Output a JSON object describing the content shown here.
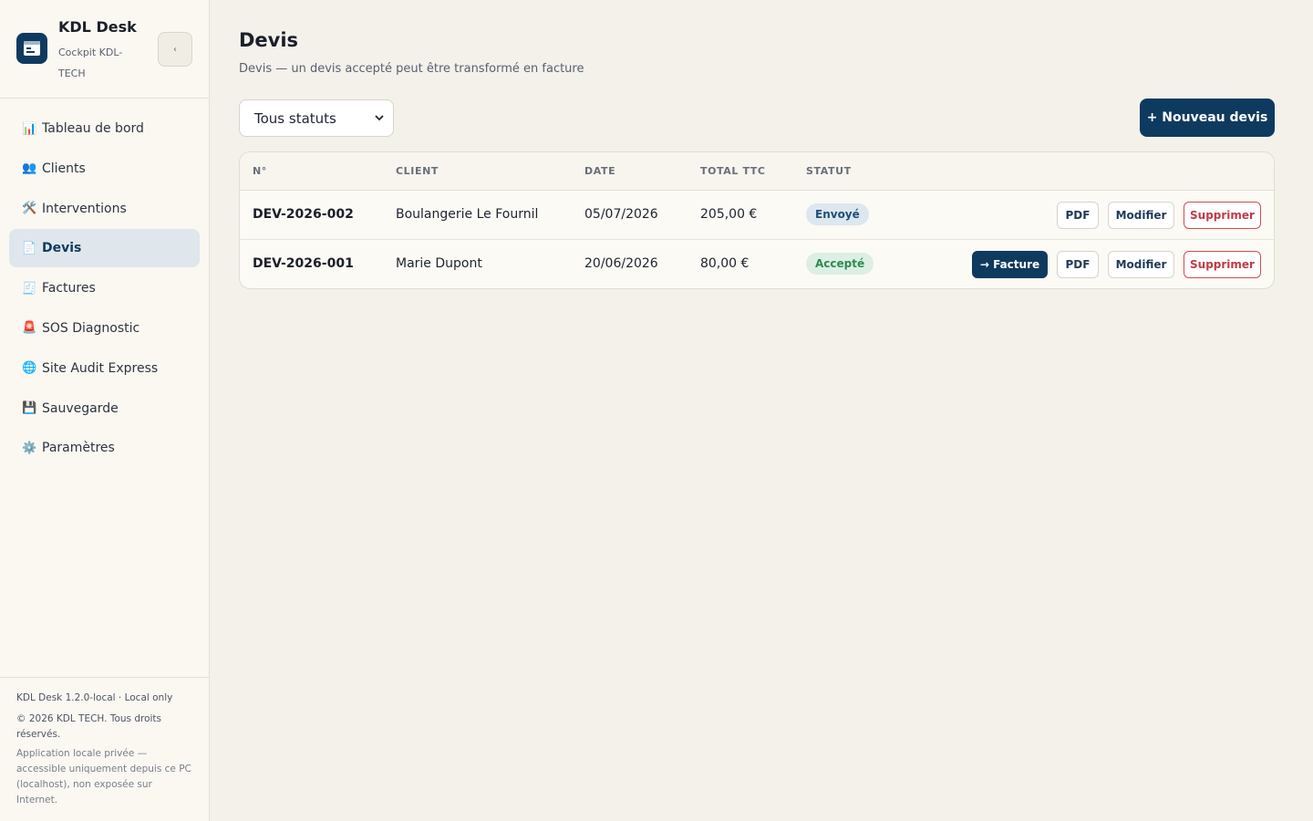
{
  "app": {
    "title": "KDL Desk",
    "subtitle": "Cockpit KDL-TECH",
    "collapse_glyph": "‹"
  },
  "nav": [
    {
      "icon": "📊",
      "icon_name": "chart-icon",
      "label": "Tableau de bord",
      "active": false
    },
    {
      "icon": "👥",
      "icon_name": "users-icon",
      "label": "Clients",
      "active": false
    },
    {
      "icon": "🛠️",
      "icon_name": "tools-icon",
      "label": "Interventions",
      "active": false
    },
    {
      "icon": "📄",
      "icon_name": "document-icon",
      "label": "Devis",
      "active": true
    },
    {
      "icon": "🧾",
      "icon_name": "receipt-icon",
      "label": "Factures",
      "active": false
    },
    {
      "icon": "🚨",
      "icon_name": "siren-icon",
      "label": "SOS Diagnostic",
      "active": false
    },
    {
      "icon": "🌐",
      "icon_name": "globe-icon",
      "label": "Site Audit Express",
      "active": false
    },
    {
      "icon": "💾",
      "icon_name": "save-icon",
      "label": "Sauvegarde",
      "active": false
    },
    {
      "icon": "⚙️",
      "icon_name": "gear-icon",
      "label": "Paramètres",
      "active": false
    }
  ],
  "footer": {
    "version": "KDL Desk 1.2.0-local · Local only",
    "copyright": "© 2026 KDL TECH. Tous droits réservés.",
    "notice": "Application locale privée — accessible uniquement depuis ce PC (localhost), non exposée sur Internet."
  },
  "page": {
    "title": "Devis",
    "subtitle": "Devis — un devis accepté peut être transformé en facture"
  },
  "filter": {
    "selected": "Tous statuts"
  },
  "new_button": "+ Nouveau devis",
  "table": {
    "columns": [
      "N°",
      "CLIENT",
      "DATE",
      "TOTAL TTC",
      "STATUT"
    ],
    "rows": [
      {
        "number": "DEV-2026-002",
        "client": "Boulangerie Le Fournil",
        "date": "05/07/2026",
        "total": "205,00 €",
        "status": "Envoyé",
        "status_kind": "sent",
        "actions": [
          "PDF",
          "Modifier",
          "Supprimer"
        ]
      },
      {
        "number": "DEV-2026-001",
        "client": "Marie Dupont",
        "date": "20/06/2026",
        "total": "80,00 €",
        "status": "Accepté",
        "status_kind": "accepted",
        "actions": [
          "→ Facture",
          "PDF",
          "Modifier",
          "Supprimer"
        ]
      }
    ]
  },
  "colors": {
    "brand": "#0f3a5f",
    "background": "#f3f1ea",
    "danger": "#c23a45",
    "success": "#2f8a52"
  }
}
